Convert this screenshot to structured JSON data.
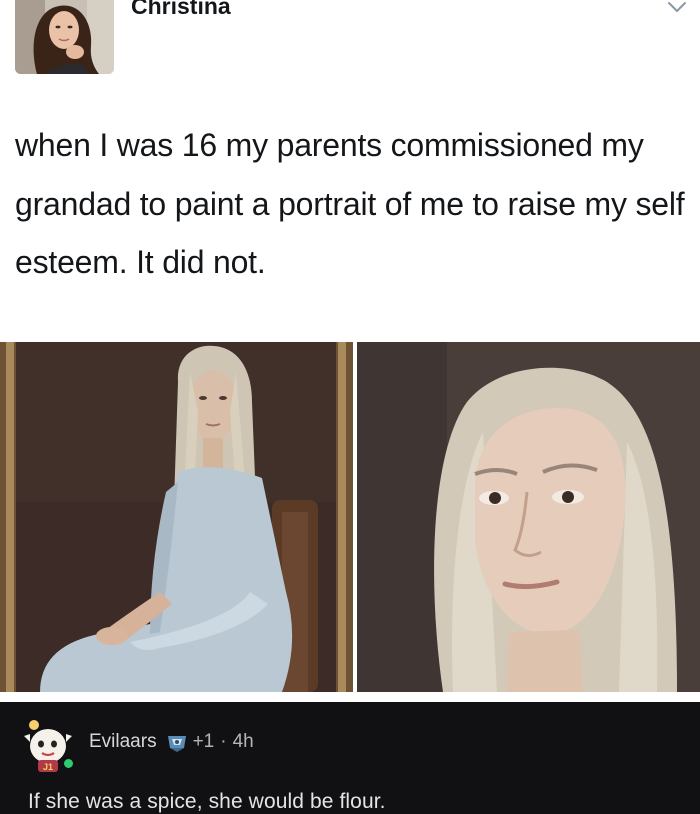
{
  "tweet": {
    "display_name": "Christina",
    "text": "when I was 16 my parents commissioned my grandad to paint a portrait of me to raise my self esteem. It did not."
  },
  "reply": {
    "username": "Evilaars",
    "score": "+1",
    "separator": "·",
    "time": "4h",
    "text": "If she was a spice, she would be flour."
  },
  "icons": {
    "header_menu": "chevron-down-icon",
    "flair": "flair-badge-icon"
  },
  "colors": {
    "tweet_text": "#14171a",
    "reply_background": "#111113",
    "reply_text": "#e4e4e4",
    "online_status": "#2ecc71"
  }
}
